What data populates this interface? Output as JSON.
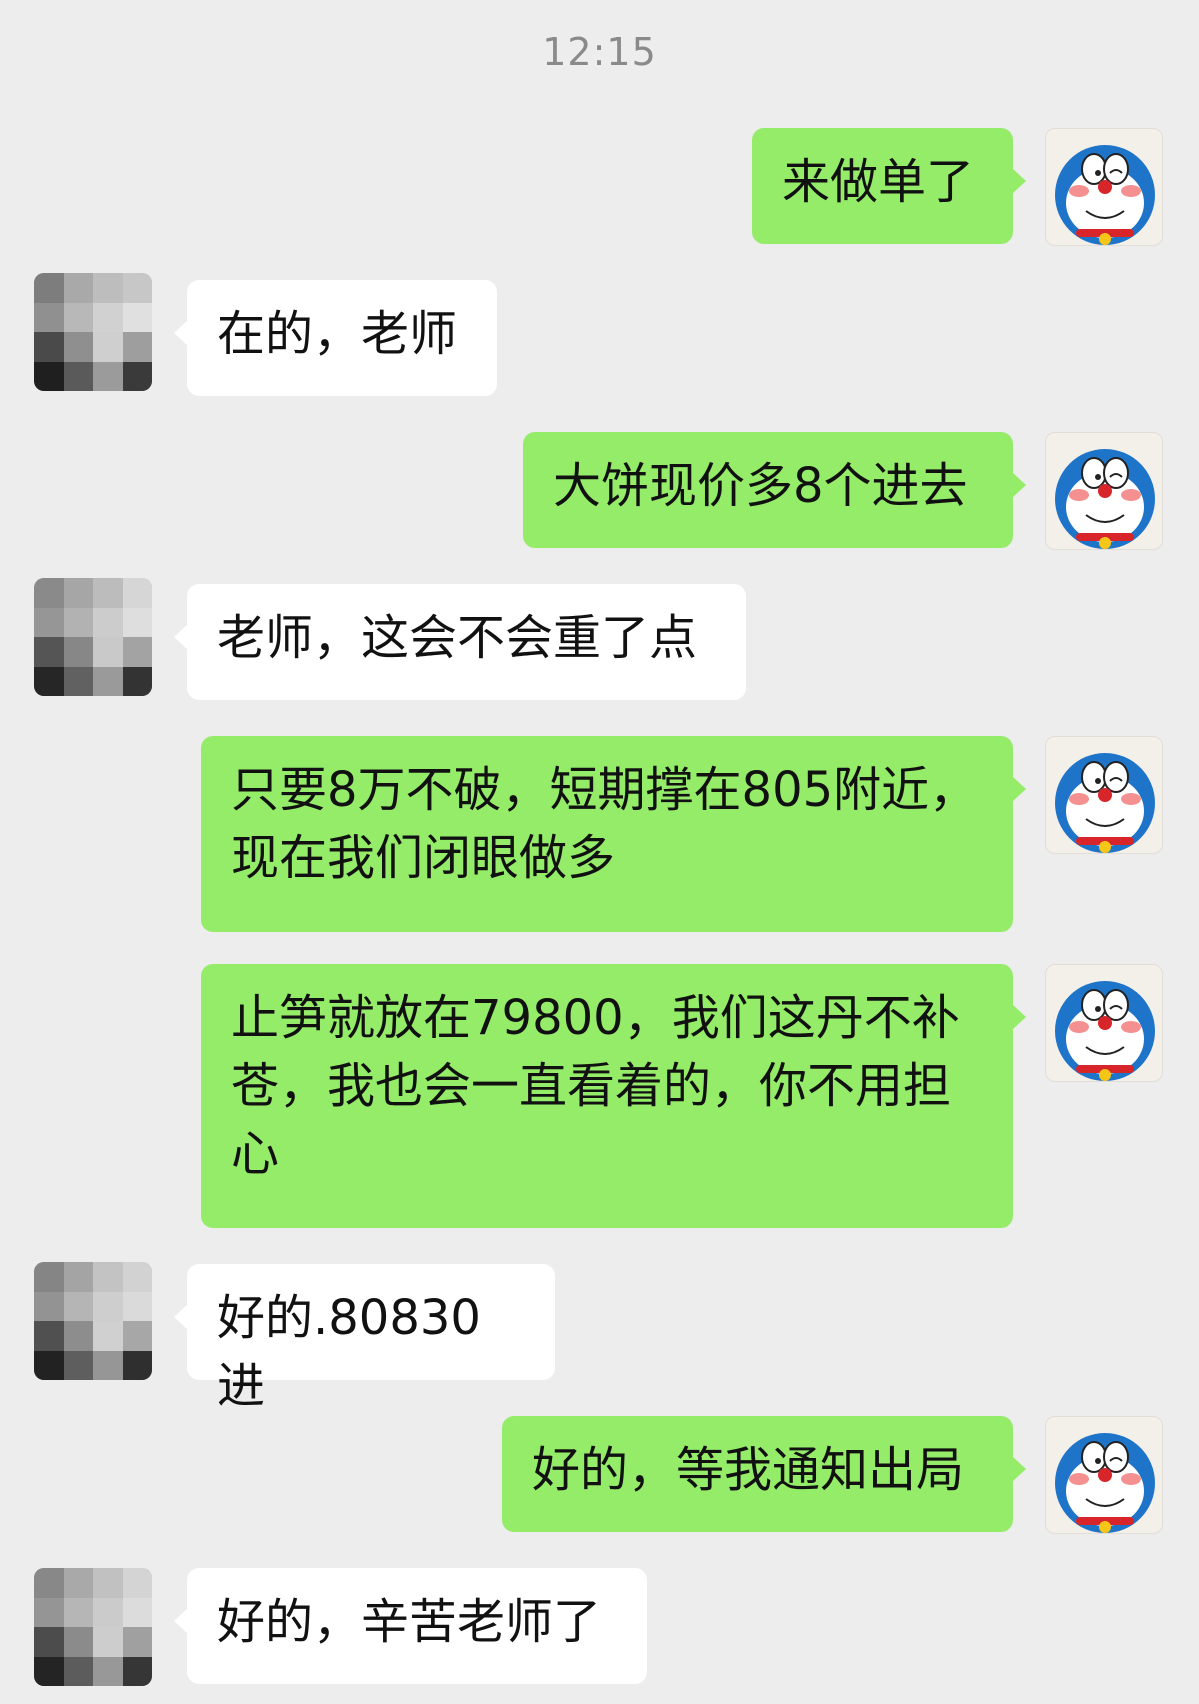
{
  "chat": {
    "timestamp": "12:15",
    "messages": [
      {
        "sender": "me",
        "text": "来做单了"
      },
      {
        "sender": "other",
        "text": "在的，老师"
      },
      {
        "sender": "me",
        "text": "大饼现价多8个进去"
      },
      {
        "sender": "other",
        "text": "老师，这会不会重了点"
      },
      {
        "sender": "me",
        "text": "只要8万不破，短期撑在805附近，现在我们闭眼做多"
      },
      {
        "sender": "me",
        "text": "止笋就放在79800，我们这丹不补苍，我也会一直看着的，你不用担心"
      },
      {
        "sender": "other",
        "text": "好的.80830进"
      },
      {
        "sender": "me",
        "text": "好的，等我通知出局"
      },
      {
        "sender": "other",
        "text": "好的，辛苦老师了"
      }
    ]
  },
  "avatars": {
    "me_icon": "cartoon-cat-avatar-icon",
    "other_icon": "pixelated-avatar"
  },
  "colors": {
    "background": "#ededed",
    "outgoing_bubble": "#95ec69",
    "incoming_bubble": "#ffffff",
    "timestamp_text": "#8a8a8a"
  }
}
